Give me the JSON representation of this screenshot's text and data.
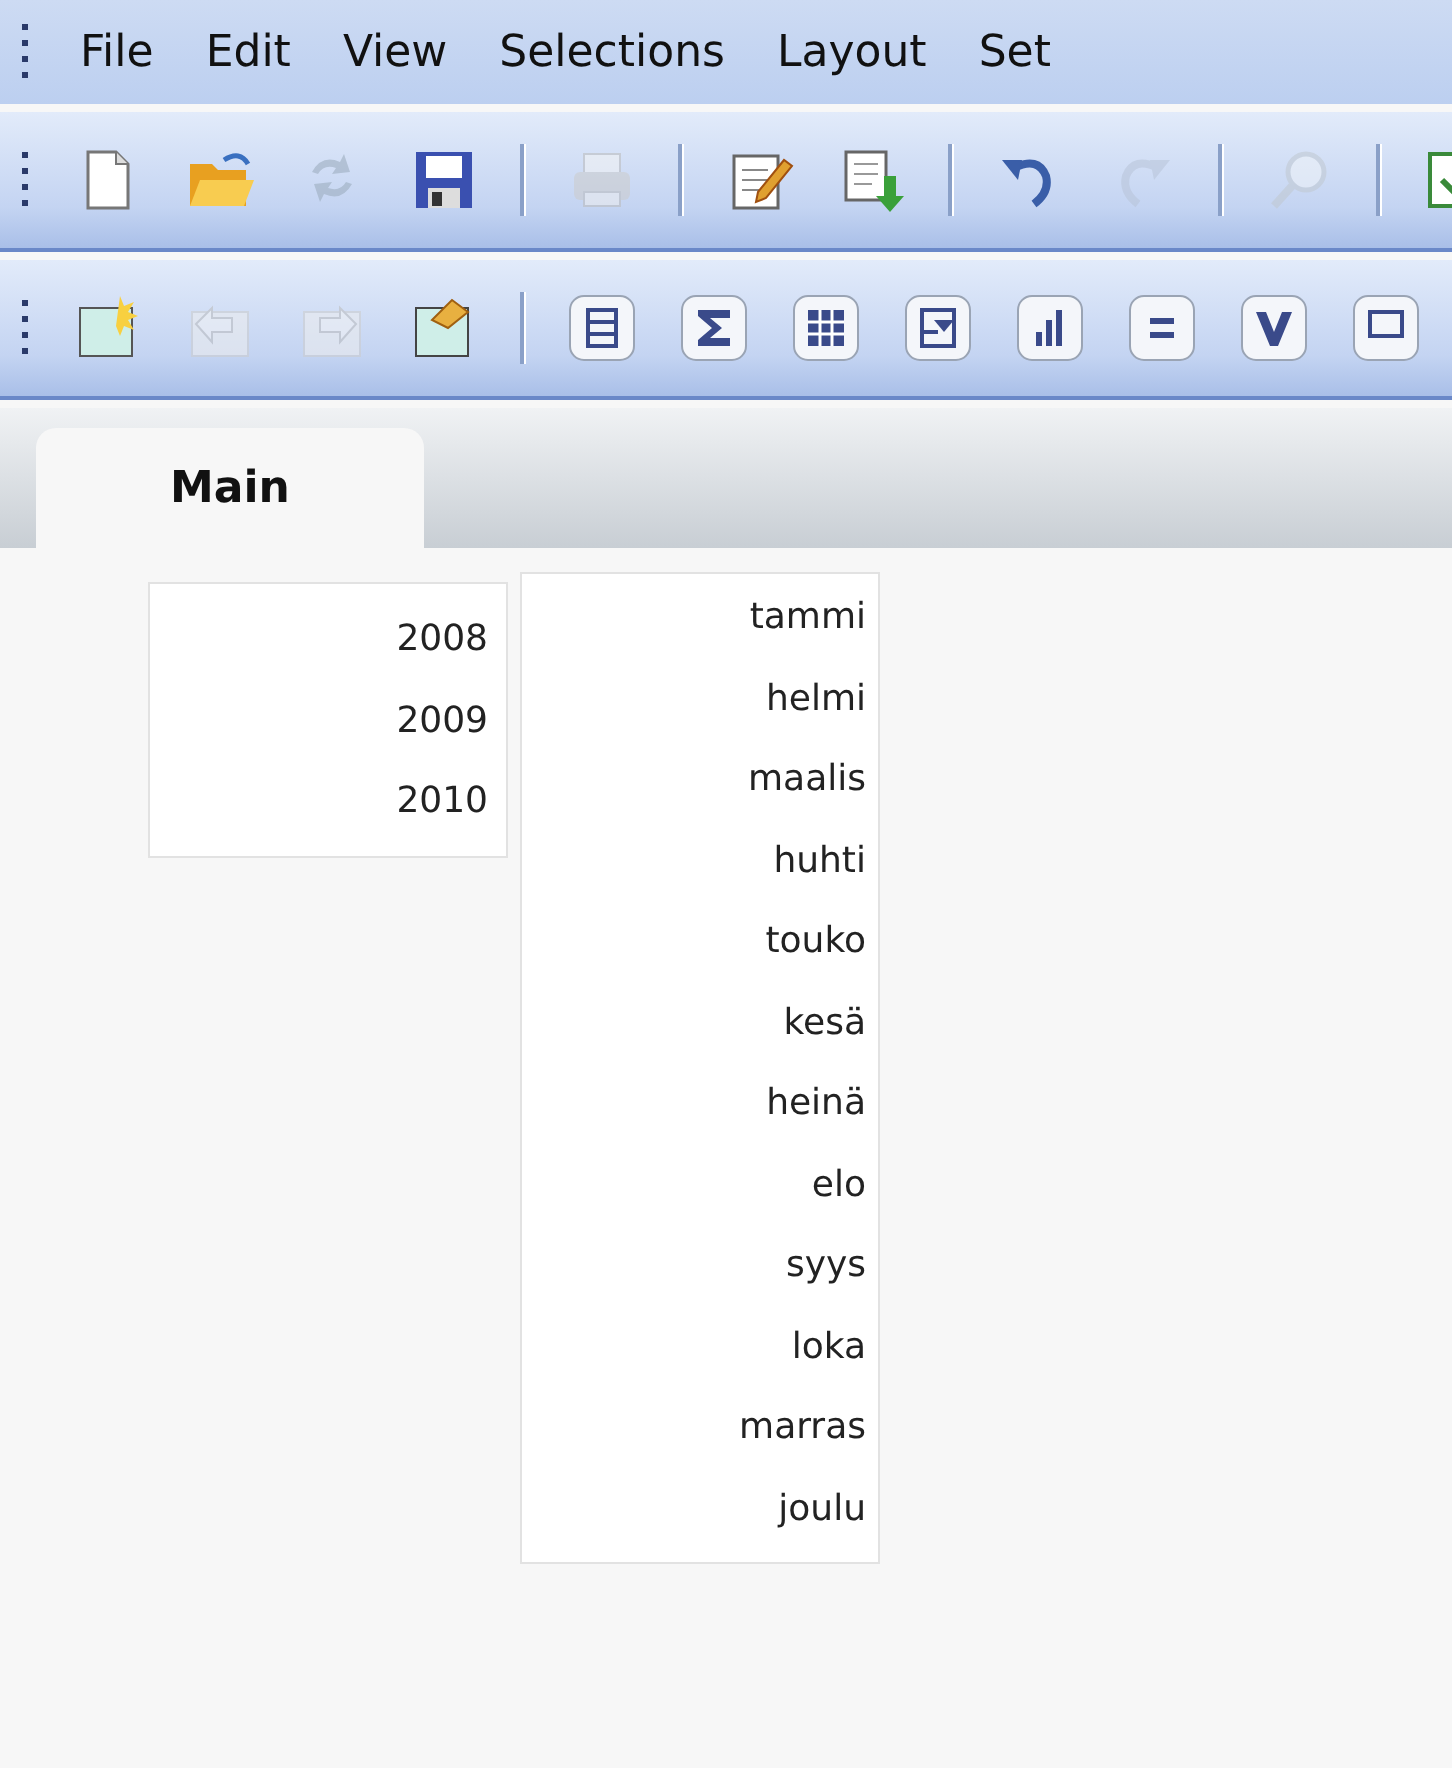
{
  "menu": [
    "File",
    "Edit",
    "View",
    "Selections",
    "Layout",
    "Set"
  ],
  "toolbars": [
    {
      "items": [
        {
          "kind": "new",
          "disabled": false
        },
        {
          "kind": "open",
          "disabled": false
        },
        {
          "kind": "reload",
          "disabled": true
        },
        {
          "kind": "save",
          "disabled": false
        },
        {
          "kind": "sep"
        },
        {
          "kind": "print",
          "disabled": true
        },
        {
          "kind": "sep"
        },
        {
          "kind": "edit",
          "disabled": false
        },
        {
          "kind": "export",
          "disabled": false
        },
        {
          "kind": "sep"
        },
        {
          "kind": "undo",
          "disabled": false
        },
        {
          "kind": "redo",
          "disabled": true
        },
        {
          "kind": "sep"
        },
        {
          "kind": "search",
          "disabled": true
        },
        {
          "kind": "sep"
        },
        {
          "kind": "greenbox",
          "disabled": false
        }
      ]
    },
    {
      "items": [
        {
          "kind": "newsheet",
          "disabled": false
        },
        {
          "kind": "back",
          "disabled": true
        },
        {
          "kind": "forward",
          "disabled": true
        },
        {
          "kind": "properties",
          "disabled": false
        },
        {
          "kind": "sep"
        },
        {
          "kind": "listbox",
          "disabled": false
        },
        {
          "kind": "sigma",
          "disabled": false
        },
        {
          "kind": "table",
          "disabled": false
        },
        {
          "kind": "multibox",
          "disabled": false
        },
        {
          "kind": "chart",
          "disabled": false
        },
        {
          "kind": "equals",
          "disabled": false
        },
        {
          "kind": "check",
          "disabled": false
        },
        {
          "kind": "comment",
          "disabled": false
        }
      ]
    }
  ],
  "tabs": [
    {
      "label": "Main",
      "selected": true
    }
  ],
  "listboxes": [
    {
      "values": [
        "2008",
        "2009",
        "2010"
      ]
    },
    {
      "values": [
        "tammi",
        "helmi",
        "maalis",
        "huhti",
        "touko",
        "kesä",
        "heinä",
        "elo",
        "syys",
        "loka",
        "marras",
        "joulu"
      ]
    }
  ]
}
